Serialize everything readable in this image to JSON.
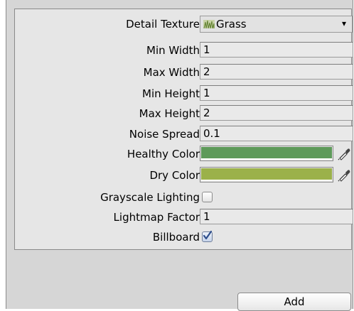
{
  "detail_texture": {
    "label": "Detail Texture",
    "value": "Grass",
    "icon": "grass-texture-icon",
    "dropdown_icon": "dropdown-arrow-icon",
    "arrow_glyph": "▾"
  },
  "min_width": {
    "label": "Min Width",
    "value": "1"
  },
  "max_width": {
    "label": "Max Width",
    "value": "2"
  },
  "min_height": {
    "label": "Min Height",
    "value": "1"
  },
  "max_height": {
    "label": "Max Height",
    "value": "2"
  },
  "noise_spread": {
    "label": "Noise Spread",
    "value": "0.1"
  },
  "healthy_color": {
    "label": "Healthy Color",
    "color": "#5e9a5a",
    "picker_icon": "eyedropper-icon"
  },
  "dry_color": {
    "label": "Dry Color",
    "color": "#9bb14a",
    "picker_icon": "eyedropper-icon"
  },
  "grayscale_lighting": {
    "label": "Grayscale Lighting",
    "checked": false
  },
  "lightmap_factor": {
    "label": "Lightmap Factor",
    "value": "1"
  },
  "billboard": {
    "label": "Billboard",
    "checked": true,
    "check_color": "#2e4e8c"
  },
  "add_button": {
    "label": "Add"
  }
}
